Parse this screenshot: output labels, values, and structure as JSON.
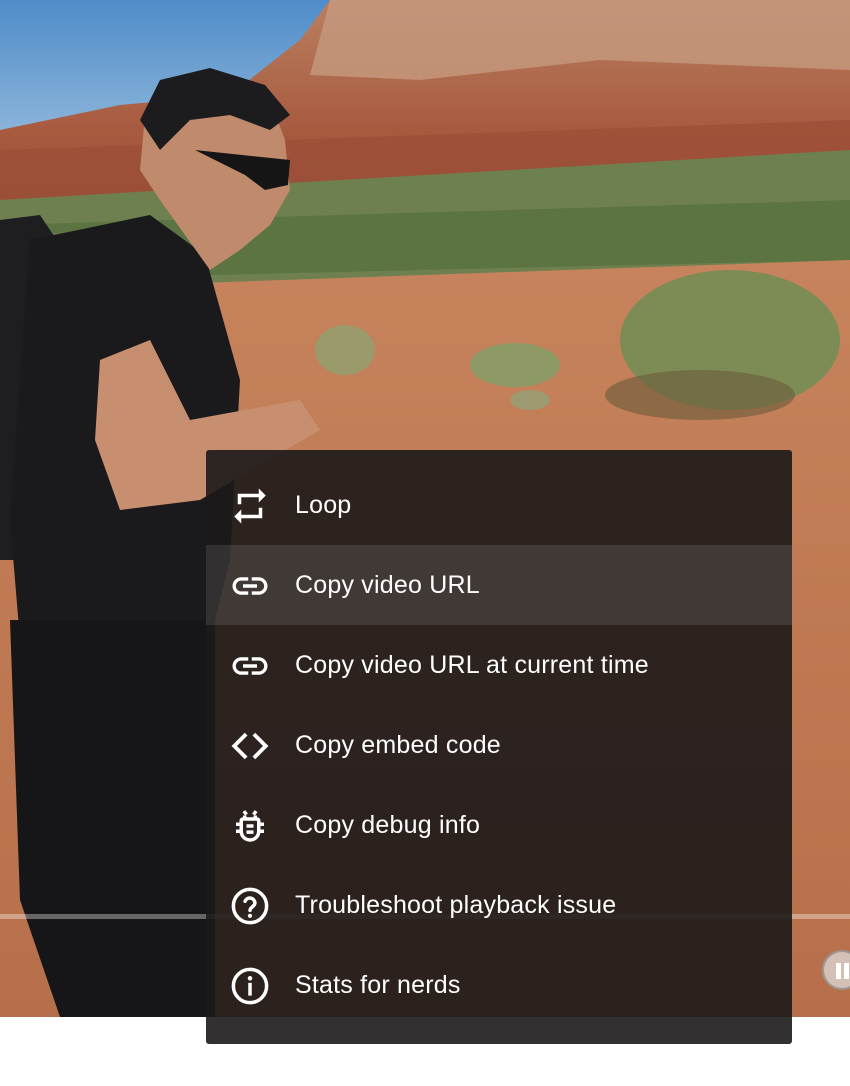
{
  "video": {
    "is_playing": true
  },
  "context_menu": {
    "items": [
      {
        "label": "Loop",
        "icon": "loop-icon"
      },
      {
        "label": "Copy video URL",
        "icon": "link-icon",
        "highlighted": true
      },
      {
        "label": "Copy video URL at current time",
        "icon": "link-icon"
      },
      {
        "label": "Copy embed code",
        "icon": "code-icon"
      },
      {
        "label": "Copy debug info",
        "icon": "bug-icon"
      },
      {
        "label": "Troubleshoot playback issue",
        "icon": "help-circle-icon"
      },
      {
        "label": "Stats for nerds",
        "icon": "info-circle-icon"
      }
    ]
  },
  "colors": {
    "menu_background": "#1c1a1a",
    "menu_text": "#ffffff"
  }
}
